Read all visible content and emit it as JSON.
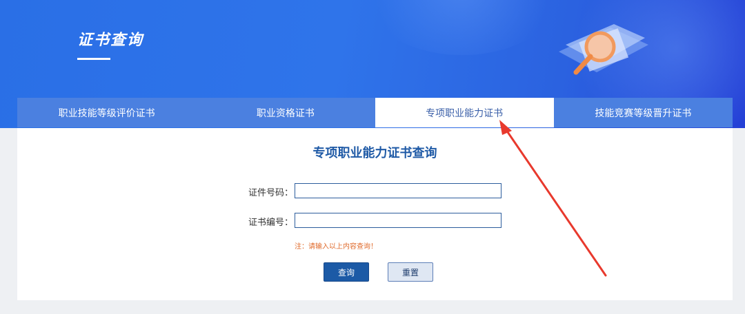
{
  "banner": {
    "title": "证书查询"
  },
  "tabs": [
    {
      "label": "职业技能等级评价证书",
      "active": false
    },
    {
      "label": "职业资格证书",
      "active": false
    },
    {
      "label": "专项职业能力证书",
      "active": true
    },
    {
      "label": "技能竞赛等级晋升证书",
      "active": false
    }
  ],
  "form": {
    "title": "专项职业能力证书查询",
    "id_label": "证件号码：",
    "id_value": "",
    "cert_label": "证书编号：",
    "cert_value": "",
    "note": "注：请输入以上内容查询！",
    "query_label": "查询",
    "reset_label": "重置"
  },
  "colors": {
    "banner_blue": "#2f74ea",
    "tab_blue": "#4b80e0",
    "title_blue": "#1f5aa6",
    "note_orange": "#e06b2c",
    "annotation_red": "#e8392d"
  }
}
